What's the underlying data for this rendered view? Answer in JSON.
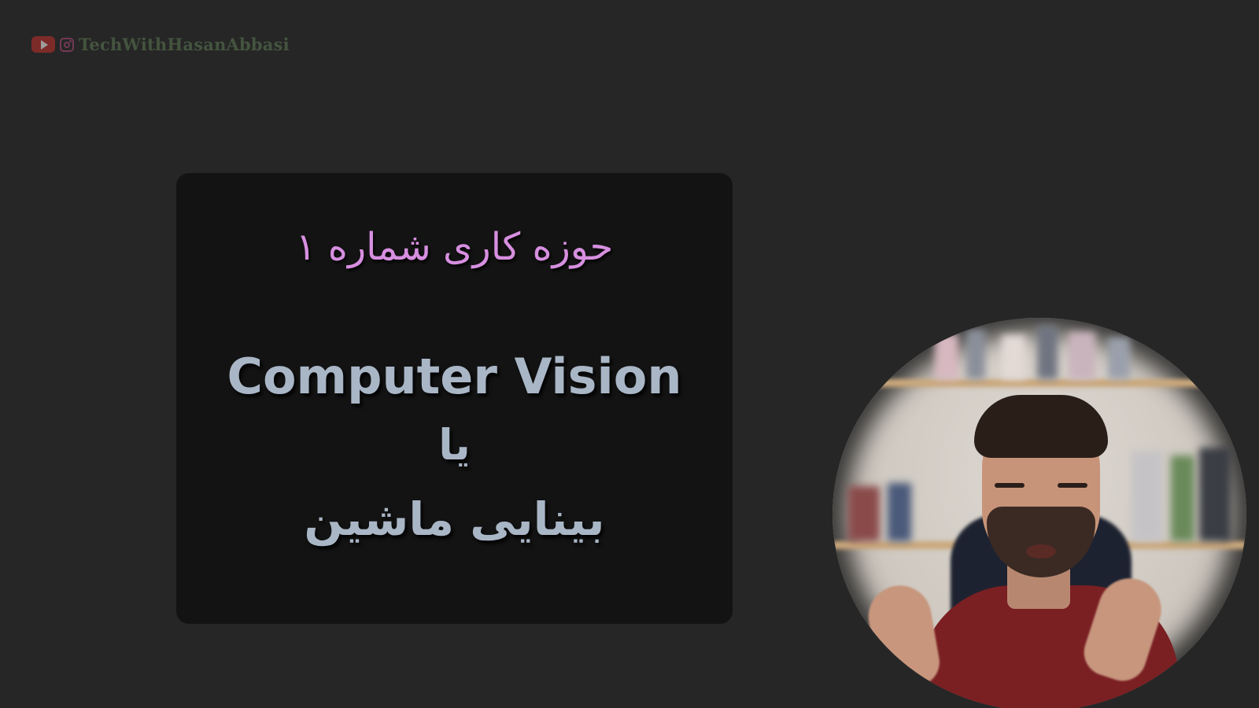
{
  "watermark": {
    "text": "TechWithHasanAbbasi",
    "icons": [
      "youtube-icon",
      "instagram-icon"
    ]
  },
  "slide": {
    "heading": "حوزه کاری شماره ۱",
    "title_en": "Computer Vision",
    "connector": "یا",
    "title_fa": "بینایی ماشین"
  },
  "colors": {
    "background": "#262626",
    "card": "#131313",
    "heading": "#d78fe0",
    "title": "#a9b6c6"
  }
}
